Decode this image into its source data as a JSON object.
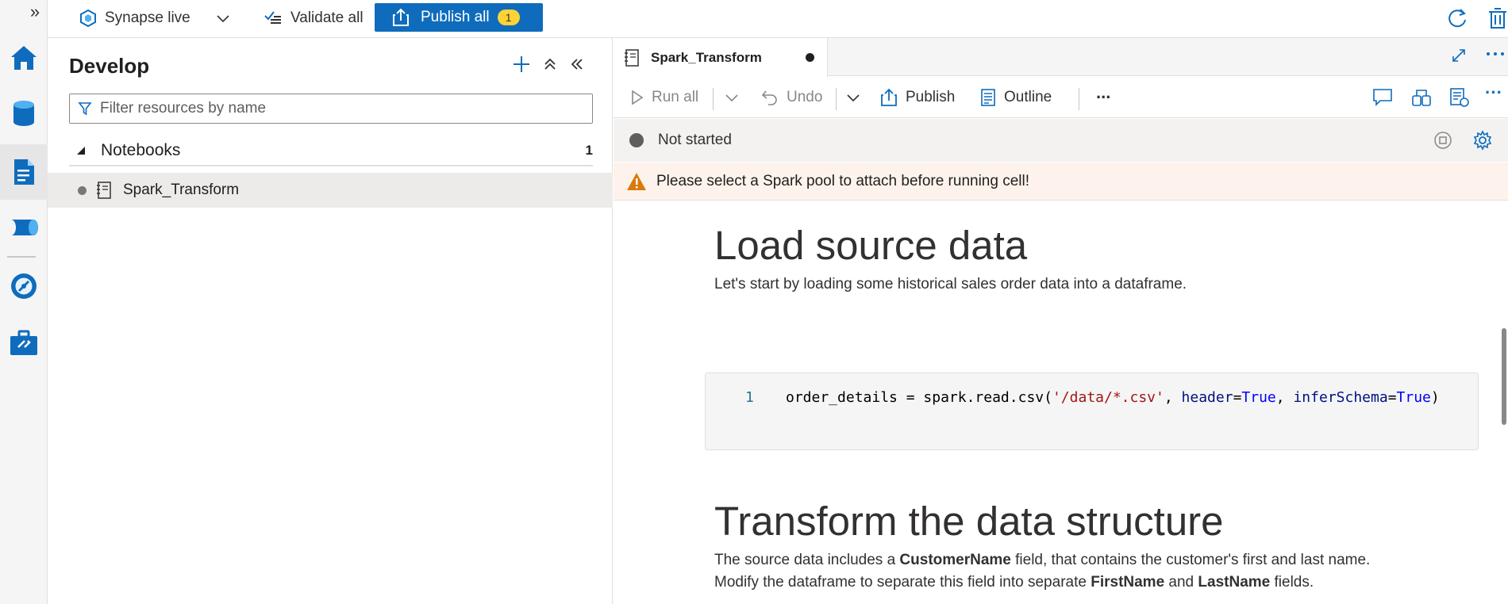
{
  "topbar": {
    "workspace_label": "Synapse live",
    "validate_label": "Validate all",
    "publish_label": "Publish all",
    "publish_count": "1"
  },
  "develop": {
    "title": "Develop",
    "filter_placeholder": "Filter resources by name",
    "section_label": "Notebooks",
    "section_count": "1",
    "items": [
      {
        "label": "Spark_Transform"
      }
    ]
  },
  "editor": {
    "tab_label": "Spark_Transform",
    "toolbar": {
      "run_all": "Run all",
      "undo": "Undo",
      "publish": "Publish",
      "outline": "Outline",
      "more": "..."
    },
    "status": "Not started",
    "warning": "Please select a Spark pool to attach before running cell!",
    "cells": {
      "heading1": "Load source data",
      "para1": "Let's start by loading some historical sales order data into a dataframe.",
      "code_line_number": "1",
      "code_var": "order_details",
      "code_mid": " = spark.read.csv(",
      "code_string": "'/data/*.csv'",
      "code_sep1": ", ",
      "code_param1": "header",
      "code_eq1": "=",
      "code_true1": "True",
      "code_sep2": ", ",
      "code_param2": "inferSchema",
      "code_eq2": "=",
      "code_true2": "True",
      "code_close": ")",
      "heading2": "Transform the data structure",
      "para2_a": "The source data includes a ",
      "para2_b": "CustomerName",
      "para2_c": " field, that contains the customer's first and last name.",
      "para3_a": "Modify the dataframe to separate this field into separate ",
      "para3_b": "FirstName",
      "para3_c": " and ",
      "para3_d": "LastName",
      "para3_e": " fields."
    }
  },
  "colors": {
    "accent": "#0f6cbd",
    "badge": "#ffd335",
    "warning_bg": "#fdf3ec",
    "warning_icon": "#d97a0b"
  }
}
